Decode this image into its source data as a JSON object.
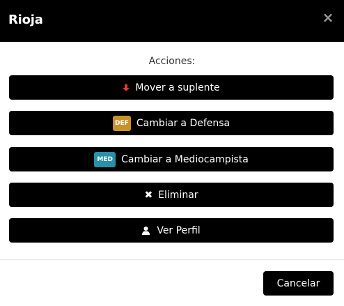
{
  "modal": {
    "title": "Rioja",
    "close_glyph": "×"
  },
  "actions": {
    "label": "Acciones:",
    "items": [
      {
        "label": "Mover a suplente",
        "icon": "arrow-down-icon",
        "icon_color": "#e53935"
      },
      {
        "label": "Cambiar a Defensa",
        "badge": "DEF",
        "badge_color": "#c8922a"
      },
      {
        "label": "Cambiar a Mediocampista",
        "badge": "MED",
        "badge_color": "#2a8fa8"
      },
      {
        "label": "Eliminar",
        "icon": "x-icon",
        "icon_glyph": "✖"
      },
      {
        "label": "Ver Perfil",
        "icon": "user-icon"
      }
    ]
  },
  "footer": {
    "cancel_label": "Cancelar"
  }
}
